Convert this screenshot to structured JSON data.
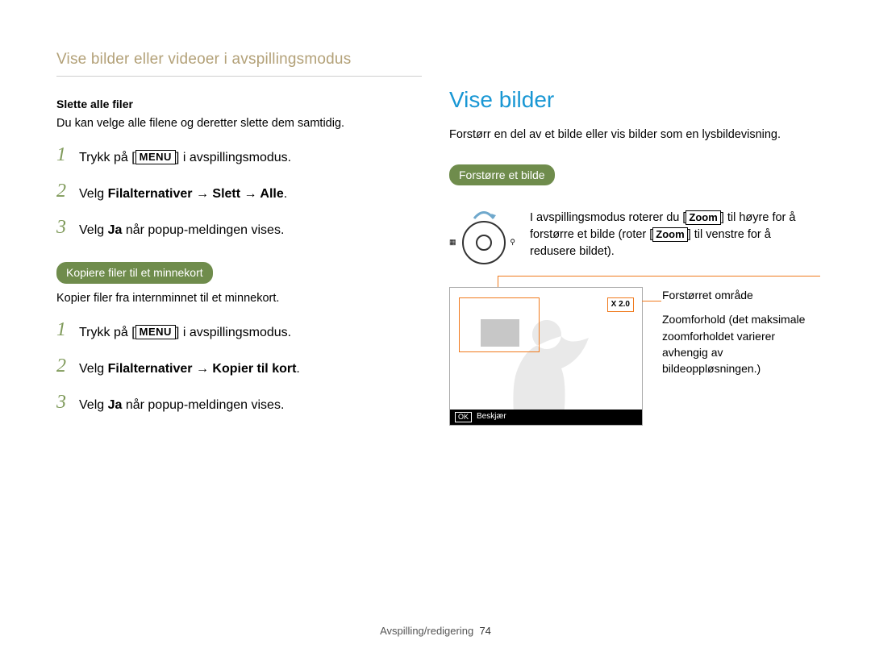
{
  "running_head": "Vise bilder eller videoer i avspillingsmodus",
  "left": {
    "delete_all_heading": "Slette alle filer",
    "delete_all_text": "Du kan velge alle filene og deretter slette dem samtidig.",
    "menu_label": "MENU",
    "steps_a": [
      {
        "pre": "Trykk på [",
        "post": "] i avspillingsmodus."
      },
      {
        "full_pre": "Velg  ",
        "bold": "Filalternativer → Slett → Alle",
        "post": "."
      },
      {
        "full_pre": "Velg ",
        "bold": "Ja",
        "post": " når popup-meldingen vises."
      }
    ],
    "copy_heading": "Kopiere filer til et minnekort",
    "copy_text": "Kopier filer fra internminnet til et minnekort.",
    "steps_b": [
      {
        "pre": "Trykk på [",
        "post": "] i avspillingsmodus."
      },
      {
        "full_pre": "Velg ",
        "bold": "Filalternativer → Kopier til kort",
        "post": "."
      },
      {
        "full_pre": "Velg ",
        "bold": "Ja",
        "post": " når popup-meldingen vises."
      }
    ]
  },
  "right": {
    "title": "Vise bilder",
    "intro": "Forstørr en del av et bilde eller vis bilder som en lysbildevisning.",
    "pill": "Forstørre et bilde",
    "zoom_text_pre": "I avspillingsmodus roterer du [",
    "zoom_word": "Zoom",
    "zoom_text_mid": "] til høyre for å forstørre et bilde (roter [",
    "zoom_text_post": "] til venstre for å redusere bildet).",
    "dial_left": "■\n□",
    "dial_right": "□\nQ",
    "callout_area": "Forstørret område",
    "callout_ratio": "Zoomforhold (det maksimale zoomforholdet varierer avhengig av bildeoppløsningen.)",
    "zoom_badge": "X 2.0",
    "ok_label": "OK",
    "crop_label": "Beskjær"
  },
  "footer": {
    "section": "Avspilling/redigering",
    "page": "74"
  }
}
